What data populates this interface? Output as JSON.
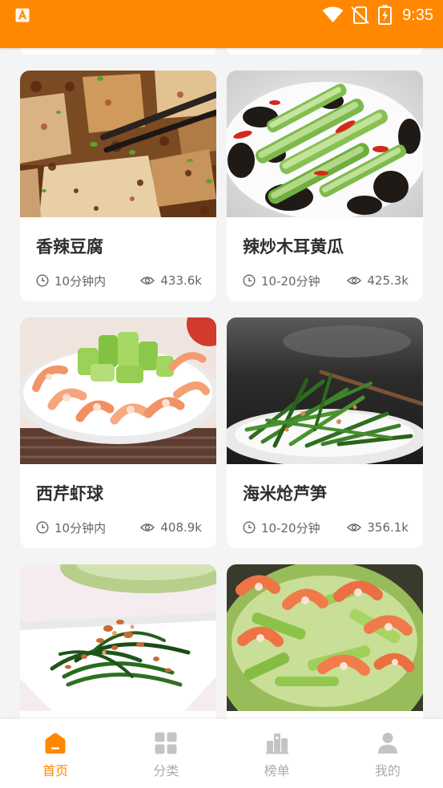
{
  "status_bar": {
    "time": "9:35",
    "icons": [
      "app-notification-icon",
      "wifi-icon",
      "no-sim-icon",
      "battery-charging-icon"
    ]
  },
  "colors": {
    "accent": "#FF8800",
    "background": "#F4F4F4",
    "card": "#FFFFFF",
    "title_text": "#2E2E2E",
    "meta_text": "#666666",
    "inactive": "#ABABAB"
  },
  "recipes": [
    {
      "title": "香辣豆腐",
      "time": "10分钟内",
      "views": "433.6k"
    },
    {
      "title": "辣炒木耳黄瓜",
      "time": "10-20分钟",
      "views": "425.3k"
    },
    {
      "title": "西芹虾球",
      "time": "10分钟内",
      "views": "408.9k"
    },
    {
      "title": "海米炝芦笋",
      "time": "10-20分钟",
      "views": "356.1k"
    }
  ],
  "meta_icons": {
    "time": "clock-icon",
    "views": "eye-icon"
  },
  "bottom_nav": {
    "tabs": [
      {
        "label": "首页",
        "icon": "home-icon",
        "active": true
      },
      {
        "label": "分类",
        "icon": "grid-icon",
        "active": false
      },
      {
        "label": "榜单",
        "icon": "ranking-icon",
        "active": false
      },
      {
        "label": "我的",
        "icon": "profile-icon",
        "active": false
      }
    ]
  }
}
